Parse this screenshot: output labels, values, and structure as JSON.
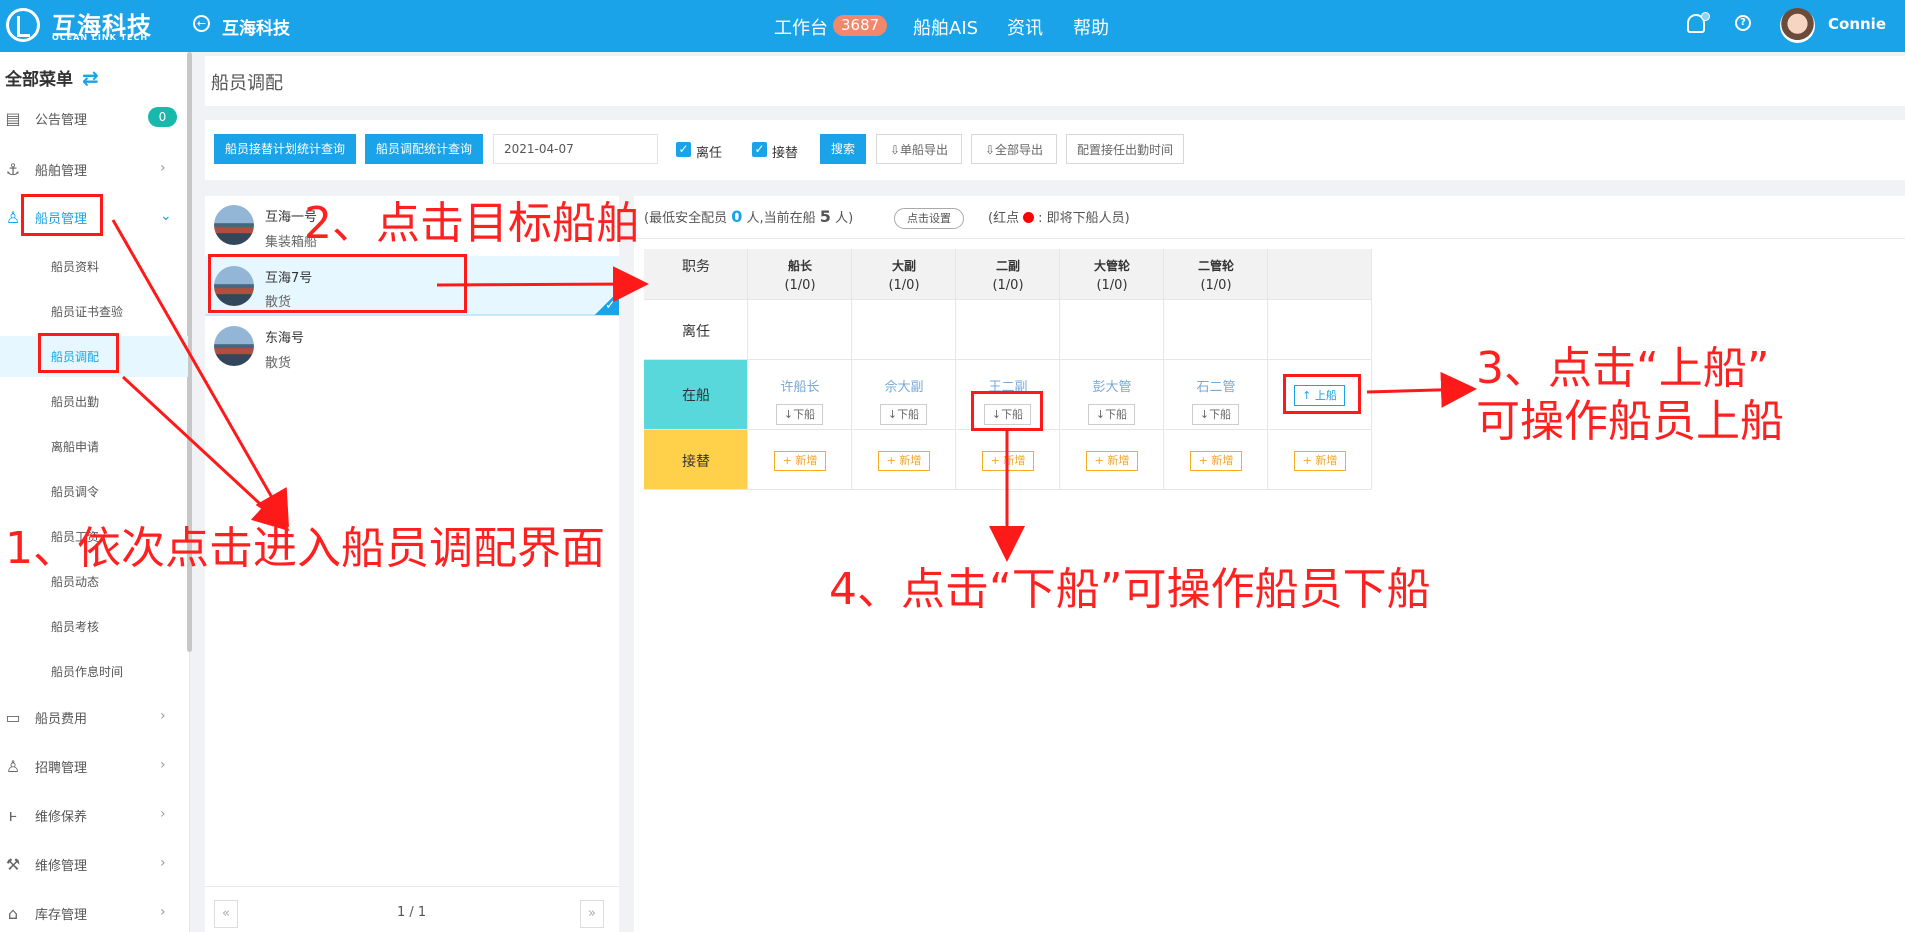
{
  "brand": {
    "name": "互海科技",
    "subtitle": "OCEAN LINK TECH",
    "current": "互海科技"
  },
  "nav": {
    "workbench": "工作台",
    "badge": "3687",
    "ais": "船舶AIS",
    "news": "资讯",
    "help": "帮助",
    "user": "Connie"
  },
  "sidebar": {
    "all_menu": "全部菜单",
    "items": [
      {
        "label": "公告管理",
        "icon": "book-icon",
        "count": "0"
      },
      {
        "label": "船舶管理",
        "icon": "anchor-icon"
      },
      {
        "label": "船员管理",
        "icon": "user-icon"
      },
      {
        "label": "船员费用",
        "icon": "wallet-icon"
      },
      {
        "label": "招聘管理",
        "icon": "user-search-icon"
      },
      {
        "label": "维修保养",
        "icon": "tool-icon"
      },
      {
        "label": "维修管理",
        "icon": "wrench-icon"
      },
      {
        "label": "库存管理",
        "icon": "home-icon"
      }
    ],
    "subitems": [
      "船员资料",
      "船员证书查验",
      "船员调配",
      "船员出勤",
      "离船申请",
      "船员调令",
      "船员工资",
      "船员动态",
      "船员考核",
      "船员作息时间"
    ]
  },
  "page": {
    "title": "船员调配"
  },
  "filters": {
    "buttons": [
      "船员接替计划统计查询",
      "船员调配统计查询"
    ],
    "date": "2021-04-07",
    "checks": [
      "离任",
      "接替"
    ],
    "search": "搜索",
    "export_single": "单船导出",
    "export_all": "全部导出",
    "config": "配置接任出勤时间"
  },
  "ships": [
    {
      "name": "互海一号",
      "type": "集装箱船"
    },
    {
      "name": "互海7号",
      "type": "散货"
    },
    {
      "name": "东海号",
      "type": "散货"
    }
  ],
  "pager": {
    "text": "1 / 1",
    "prev": "«",
    "next": "»"
  },
  "summary": {
    "min_label": "(最低安全配员",
    "min_value": "0",
    "min_unit": "人,当前在船",
    "onboard_value": "5",
    "onboard_unit": "人)",
    "set_btn": "点击设置",
    "legend_left": "(红点",
    "legend_right": ":  即将下船人员)"
  },
  "roster": {
    "duty": "职务",
    "rows": [
      "离任",
      "在船",
      "接替"
    ],
    "roles": [
      {
        "name": "船长",
        "count": "(1/0)",
        "crew": "许船长"
      },
      {
        "name": "大副",
        "count": "(1/0)",
        "crew": "佘大副"
      },
      {
        "name": "二副",
        "count": "(1/0)",
        "crew": "王二副"
      },
      {
        "name": "大管轮",
        "count": "(1/0)",
        "crew": "彭大管"
      },
      {
        "name": "二管轮",
        "count": "(1/0)",
        "crew": "石二管"
      }
    ],
    "down": "↓下船",
    "add": "+ 新增",
    "up": "↑ 上船"
  },
  "annotations": {
    "step1": "1、依次点击进入船员调配界面",
    "step2": "2、点击目标船舶",
    "step3_line1": "3、点击“上船”",
    "step3_line2": "可操作船员上船",
    "step4": "4、点击“下船”可操作船员下船"
  },
  "colors": {
    "primary": "#1aa3e8",
    "onboard": "#59d8db",
    "replace": "#ffd14a",
    "annotation": "#ff1a1a"
  }
}
